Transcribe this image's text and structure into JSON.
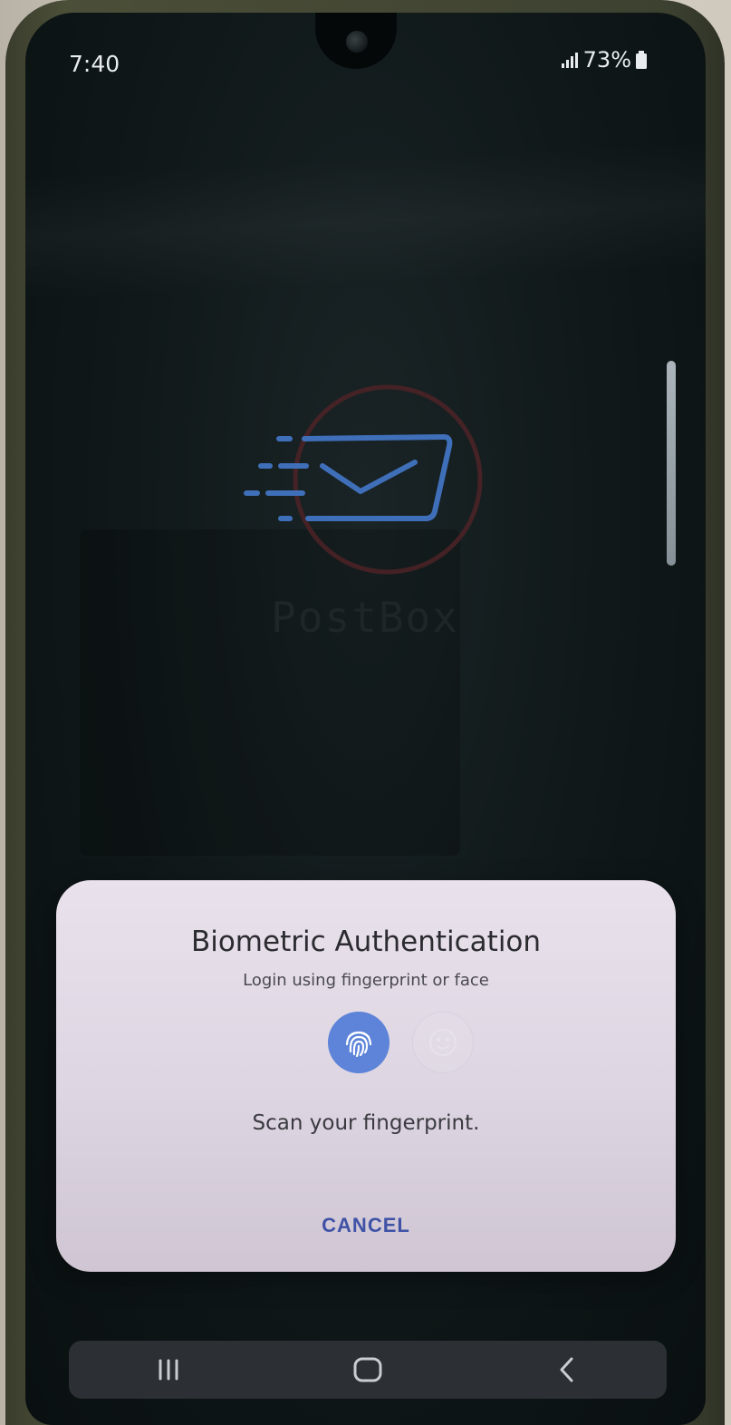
{
  "status_bar": {
    "time": "7:40",
    "battery_percent": "73%",
    "signal_icon": "signal-bars-icon",
    "battery_icon": "battery-icon"
  },
  "app": {
    "brand_name": "PostBox",
    "logo_icon": "envelope-speed-icon",
    "logo_colors": {
      "envelope": "#3f6fb8",
      "ring": "#5a2a2e"
    }
  },
  "biometric_dialog": {
    "title": "Biometric Authentication",
    "subtitle": "Login using fingerprint or face",
    "methods": [
      {
        "icon": "fingerprint-icon",
        "selected": true
      },
      {
        "icon": "face-icon",
        "selected": false
      }
    ],
    "message": "Scan your fingerprint.",
    "cancel_label": "CANCEL",
    "accent_color": "#5d84d8"
  },
  "nav_bar": {
    "recents_icon": "recents-icon",
    "home_icon": "home-icon",
    "back_icon": "back-icon"
  }
}
